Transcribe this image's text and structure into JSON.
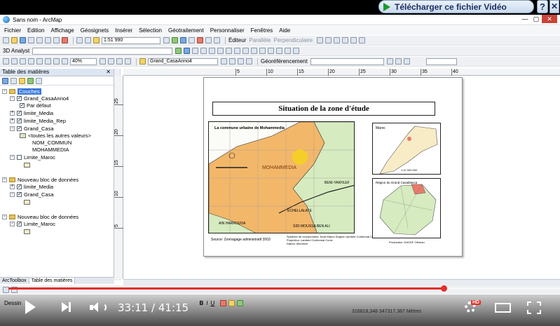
{
  "video_overlay": {
    "download_label": "Télécharger ce fichier Vidéo",
    "help_label": "?",
    "time": "33:11 / 41:15"
  },
  "window": {
    "title": "Sans nom - ArcMap"
  },
  "menu": [
    "Fichier",
    "Edition",
    "Affichage",
    "Géosignets",
    "Insérer",
    "Sélection",
    "Géotraitement",
    "Personnaliser",
    "Fenêtres",
    "Aide"
  ],
  "toolbar": {
    "scale": "1:51 990",
    "editor": "Éditeur",
    "parallel": "Parallèle",
    "perpendicular": "Perpendiculaire",
    "analyst": "3D Analyst",
    "zoom": "40%",
    "layer": "Grand_CasaAnno4",
    "georef": "Géoréférencement",
    "draw": "Dessin",
    "bold": "B",
    "italic": "I",
    "underline": "U"
  },
  "toc": {
    "title": "Table des matières",
    "frames": [
      {
        "name": "Couches",
        "layers": [
          {
            "name": "Grand_CasaAnno4",
            "sub": [
              "Par défaut"
            ]
          },
          {
            "name": "limite_Media"
          },
          {
            "name": "limite_Media_Rep"
          },
          {
            "name": "Grand_Casa",
            "sub": [
              "<toutes les autres valeurs>",
              "NOM_COMMUN",
              "MOHAMMEDIA"
            ]
          },
          {
            "name": "Limite_Maroc"
          }
        ]
      },
      {
        "name": "Nouveau bloc de données",
        "layers": [
          {
            "name": "limite_Media"
          },
          {
            "name": "Grand_Casa"
          }
        ]
      },
      {
        "name": "Nouveau bloc de données",
        "layers": [
          {
            "name": "Limite_Maroc"
          }
        ]
      }
    ],
    "tabs": [
      "ArcToolbox",
      "Table des matières"
    ]
  },
  "ruler": {
    "h": [
      "5",
      "10",
      "15",
      "20",
      "25",
      "30",
      "35",
      "40"
    ],
    "v": [
      "25",
      "20",
      "15",
      "10",
      "5"
    ]
  },
  "layout": {
    "title": "Situation de la zone d'étude",
    "main_map_title": "La commune urbaine de Mohammedia",
    "city_label": "MOHAMMEDIA",
    "labels": [
      "AIN HARROUDA",
      "ECHELLALATE",
      "BENI-YAKHLEF",
      "SIDI MOUSSA BEN ALI"
    ],
    "source": "Source: Zonnagage administratif 2003",
    "projection_note": "Système de coordonnées: Nord Maroc Degree Lambert Conformal Conic",
    "projection_note2": "Projection: Lambert Conformal Conic",
    "datum_note": "Datum: Merchich",
    "inset1_label": "Maroc",
    "inset1_scale": "1:12 000 000",
    "inset2_label": "Région du Grand Casablanca",
    "author": "Production: DAOUF Othman"
  },
  "status": {
    "coords": "316818,348  347317,387 Mètres"
  },
  "colors": {
    "accent_red": "#e52d27",
    "land_orange": "#f3b76a",
    "land_green": "#d6ebc0",
    "land_cream": "#f7ecc5"
  }
}
